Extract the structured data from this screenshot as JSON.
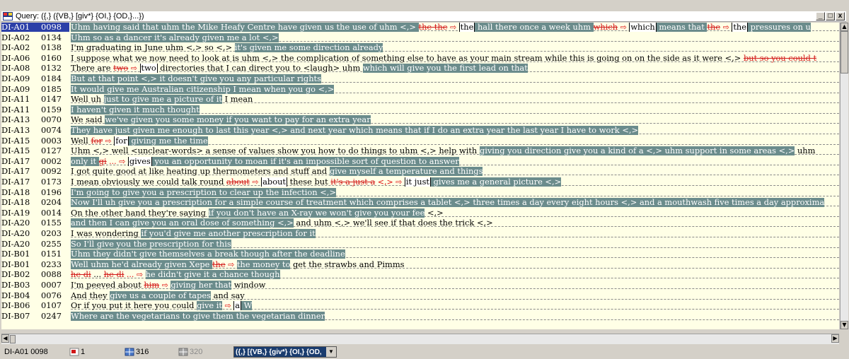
{
  "window": {
    "title": "Query: ({,} ({VB,} [giv*} {OI,} {OD,}...})",
    "buttons": [
      "_",
      "□",
      "x"
    ]
  },
  "rows": [
    {
      "id": "DI-A01",
      "num": "0098",
      "selected": true,
      "segments": [
        {
          "t": "Uhm having said that uhm the Mike Heafy Centre have given us the use of ",
          "hl": true
        },
        {
          "t": "uhm",
          "hl": true
        },
        {
          "t": " <,> ",
          "hl": true
        },
        {
          "t": "the the",
          "strike": true
        },
        {
          "t": " ⇨ ",
          "arrow": true
        },
        {
          "t": "the",
          "box": true
        },
        {
          "t": " hall there once a week uhm ",
          "hl": true
        },
        {
          "t": "which",
          "strike": true
        },
        {
          "t": " ⇨ ",
          "arrow": true
        },
        {
          "t": "which",
          "box": true
        },
        {
          "t": " means that ",
          "hl": true
        },
        {
          "t": "the",
          "strike": true
        },
        {
          "t": " ⇨ ",
          "arrow": true
        },
        {
          "t": "the",
          "box": true
        },
        {
          "t": " pressures on u",
          "hl": true
        }
      ]
    },
    {
      "id": "DI-A02",
      "num": "0134",
      "segments": [
        {
          "t": "Uhm so as a dancer it's already given me a lot <,>",
          "hl": true
        }
      ]
    },
    {
      "id": "DI-A02",
      "num": "0138",
      "segments": [
        {
          "t": "I'm graduating in June uhm <,> so <,> "
        },
        {
          "t": "it's given me some direction already",
          "hl": true
        }
      ]
    },
    {
      "id": "DI-A06",
      "num": "0160",
      "segments": [
        {
          "t": "I suppose what we now need to look at is uhm <,> the complication of something else to have as your main stream while this is going on on the side as it were <,> "
        },
        {
          "t": "but so you could t",
          "strike": true
        }
      ]
    },
    {
      "id": "DI-A08",
      "num": "0132",
      "segments": [
        {
          "t": "There are "
        },
        {
          "t": "two",
          "strike": true
        },
        {
          "t": " ⇨ ",
          "arrow": true
        },
        {
          "t": "two",
          "box": true
        },
        {
          "t": " directories that I can direct you to <laugh> uhm "
        },
        {
          "t": "which will give you the first lead on that",
          "hl": true
        }
      ]
    },
    {
      "id": "DI-A09",
      "num": "0184",
      "segments": [
        {
          "t": "But at that point <,> it doesn't give you any particular rights",
          "hl": true
        }
      ]
    },
    {
      "id": "DI-A09",
      "num": "0185",
      "segments": [
        {
          "t": "It would give me Australian citizenship I mean when you go <,>",
          "hl": true
        }
      ]
    },
    {
      "id": "DI-A11",
      "num": "0147",
      "segments": [
        {
          "t": "Well uh "
        },
        {
          "t": "just to give me a picture of it",
          "hl": true
        },
        {
          "t": " I mean"
        }
      ]
    },
    {
      "id": "DI-A11",
      "num": "0159",
      "segments": [
        {
          "t": "I haven't given it much thought",
          "hl": true
        }
      ]
    },
    {
      "id": "DI-A13",
      "num": "0070",
      "segments": [
        {
          "t": "We said "
        },
        {
          "t": "we've given you some money if you want to pay for an extra year",
          "hl": true
        }
      ]
    },
    {
      "id": "DI-A13",
      "num": "0074",
      "segments": [
        {
          "t": "They have just given me enough to last this year <,> and next year which means that if I do an extra year the last year I have to work <,>",
          "hl": true
        }
      ]
    },
    {
      "id": "DI-A15",
      "num": "0003",
      "segments": [
        {
          "t": "Well "
        },
        {
          "t": "for",
          "strike": true
        },
        {
          "t": " ⇨ ",
          "arrow": true
        },
        {
          "t": "for",
          "box": true
        },
        {
          "t": " giving me the time",
          "hl": true
        }
      ]
    },
    {
      "id": "DI-A15",
      "num": "0127",
      "segments": [
        {
          "t": "Uhm <,> well <unclear-words> a sense of values show you how to do things to uhm <,> help with "
        },
        {
          "t": "giving you direction give you a kind of a <,> uhm support in some areas <,>",
          "hl": true
        },
        {
          "t": " uhm"
        }
      ]
    },
    {
      "id": "DI-A17",
      "num": "0002",
      "segments": [
        {
          "t": "only it ",
          "hl": true
        },
        {
          "t": "gi",
          "strike": true
        },
        {
          "t": " ... ⇨ ",
          "arrow": true
        },
        {
          "t": "gives",
          "box": true
        },
        {
          "t": " you an opportunity to moan if it's an impossible sort of question to answer",
          "hl": true
        }
      ]
    },
    {
      "id": "DI-A17",
      "num": "0092",
      "segments": [
        {
          "t": "I got quite good at like heating up thermometers and stuff and "
        },
        {
          "t": "give myself a temperature and things",
          "hl": true
        }
      ]
    },
    {
      "id": "DI-A17",
      "num": "0173",
      "segments": [
        {
          "t": "I mean obviously we could talk round "
        },
        {
          "t": "about",
          "strike": true
        },
        {
          "t": " ⇨ ",
          "arrow": true
        },
        {
          "t": "about",
          "box": true
        },
        {
          "t": " these but "
        },
        {
          "t": "it's a just a",
          "strike": true
        },
        {
          "t": " <,> ⇨ ",
          "arrow": true
        },
        {
          "t": "it just",
          "box": true
        },
        {
          "t": " gives me a general picture <,>",
          "hl": true
        }
      ]
    },
    {
      "id": "DI-A18",
      "num": "0196",
      "segments": [
        {
          "t": "I'm going to give you a prescription to clear up the infection <,>",
          "hl": true
        }
      ]
    },
    {
      "id": "DI-A18",
      "num": "0204",
      "segments": [
        {
          "t": "Now I'll uh give you a prescription for a simple course of treatment which comprises a tablet <,> three times a day every eight hours <,> and a mouthwash five times a day approxima",
          "hl": true
        }
      ]
    },
    {
      "id": "DI-A19",
      "num": "0014",
      "segments": [
        {
          "t": "On the other hand they're saying "
        },
        {
          "t": "if you don't have an X-ray we won't give you your fee",
          "hl": true
        },
        {
          "t": " <,>"
        }
      ]
    },
    {
      "id": "DI-A20",
      "num": "0155",
      "segments": [
        {
          "t": "and then I can give you an oral dose of something <,>",
          "hl": true
        },
        {
          "t": " and uhm <,> we'll see if that does the trick <,>"
        }
      ]
    },
    {
      "id": "DI-A20",
      "num": "0203",
      "segments": [
        {
          "t": "I was wondering "
        },
        {
          "t": "if you'd give me another prescription for it",
          "hl": true
        }
      ]
    },
    {
      "id": "DI-A20",
      "num": "0255",
      "segments": [
        {
          "t": "So I'll give you the prescription for this",
          "hl": true
        }
      ]
    },
    {
      "id": "DI-B01",
      "num": "0151",
      "segments": [
        {
          "t": "Uhm they didn't give themselves a break though after the deadline",
          "hl": true
        }
      ]
    },
    {
      "id": "DI-B01",
      "num": "0233",
      "segments": [
        {
          "t": "Well uhm he'd already given Xepe ",
          "hl": true
        },
        {
          "t": "the",
          "strike": true
        },
        {
          "t": " ⇨ ",
          "arrow": true
        },
        {
          "t": "the money to",
          "hl": true
        },
        {
          "t": " get the strawbs and Pimms"
        }
      ]
    },
    {
      "id": "DI-B02",
      "num": "0088",
      "segments": [
        {
          "t": "he di",
          "strike": true
        },
        {
          "t": " ... "
        },
        {
          "t": "he di",
          "strike": true
        },
        {
          "t": " ... ⇨ ",
          "arrow": true
        },
        {
          "t": "he didn't give it a chance though",
          "hl": true
        }
      ]
    },
    {
      "id": "DI-B03",
      "num": "0007",
      "segments": [
        {
          "t": "I'm peeved about "
        },
        {
          "t": "him",
          "strike": true
        },
        {
          "t": " ⇨ ",
          "arrow": true
        },
        {
          "t": "giving her that",
          "hl": true
        },
        {
          "t": " window"
        }
      ]
    },
    {
      "id": "DI-B04",
      "num": "0076",
      "segments": [
        {
          "t": "And they "
        },
        {
          "t": "give us a couple of tapes",
          "hl": true
        },
        {
          "t": " and say"
        }
      ]
    },
    {
      "id": "DI-B06",
      "num": "0107",
      "segments": [
        {
          "t": "Or if you put it here you could "
        },
        {
          "t": "give it",
          "hl": true
        },
        {
          "t": " ⇨ ",
          "arrow": true
        },
        {
          "t": "a",
          "box": true
        },
        {
          "t": " W",
          "hl": true
        }
      ]
    },
    {
      "id": "DI-B07",
      "num": "0247",
      "segments": [
        {
          "t": "Where are the vegetarians to give them the vegetarian dinner",
          "hl": true
        }
      ]
    }
  ],
  "status": {
    "current_ref": "DI-A01  0098",
    "item1": "1",
    "item2": "316",
    "item3": "320",
    "query_label": "({,} [{VB,} {giv*} {OI,} {OD,"
  }
}
